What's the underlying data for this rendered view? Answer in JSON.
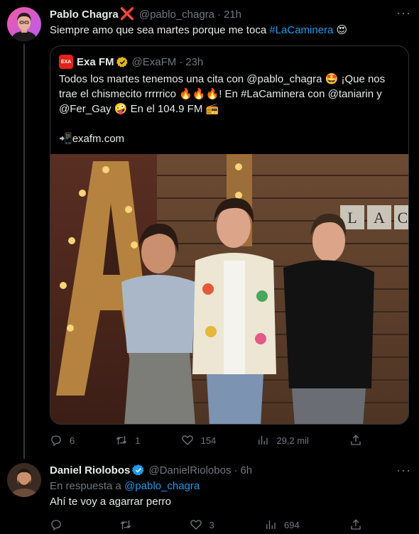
{
  "tweet1": {
    "author_name": "Pablo Chagra",
    "name_suffix": "❌",
    "handle": "@pablo_chagra",
    "separator": "·",
    "time": "21h",
    "text_before": "Siempre amo que sea martes porque me toca ",
    "hashtag": "#LaCaminera",
    "text_after": " 😍",
    "more": "···",
    "avatar_icon": "profile-avatar"
  },
  "quote": {
    "author_name": "Exa FM",
    "logo_text": "EXA",
    "handle": "@ExaFM",
    "separator": "·",
    "time": "23h",
    "line1": "Todos los martes tenemos una cita con @pablo_chagra 🤩 ¡Que nos",
    "line2": "trae el chismecito rrrrrico 🔥🔥🔥! En #LaCaminera  con @taniarin y",
    "line3": "@Fer_Gay 🤪 En el 104.9 FM 📻",
    "link_prefix": "📲",
    "link": "exafm.com",
    "verified_icon": "gold-verified-badge",
    "letter_tiles": [
      "L",
      "A",
      "C"
    ]
  },
  "tweet1_actions": {
    "replies": "6",
    "retweets": "1",
    "likes": "154",
    "views": "29,2 mil"
  },
  "tweet2": {
    "author_name": "Daniel Riolobos",
    "handle": "@DanielRiolobos",
    "separator": "·",
    "time": "6h",
    "reply_to_prefix": "En respuesta a ",
    "reply_to_handle": "@pablo_chagra",
    "text": "Ahí te voy a agarrar perro",
    "more": "···",
    "verified_icon": "blue-verified-badge"
  },
  "tweet2_actions": {
    "replies": "",
    "retweets": "",
    "likes": "3",
    "views": "694"
  },
  "colors": {
    "background": "#000000",
    "text": "#e7e9ea",
    "muted": "#71767b",
    "link": "#1d9bf0",
    "border": "#2f3336",
    "exa_red": "#e2231a",
    "gold_badge": "#e2b719"
  }
}
